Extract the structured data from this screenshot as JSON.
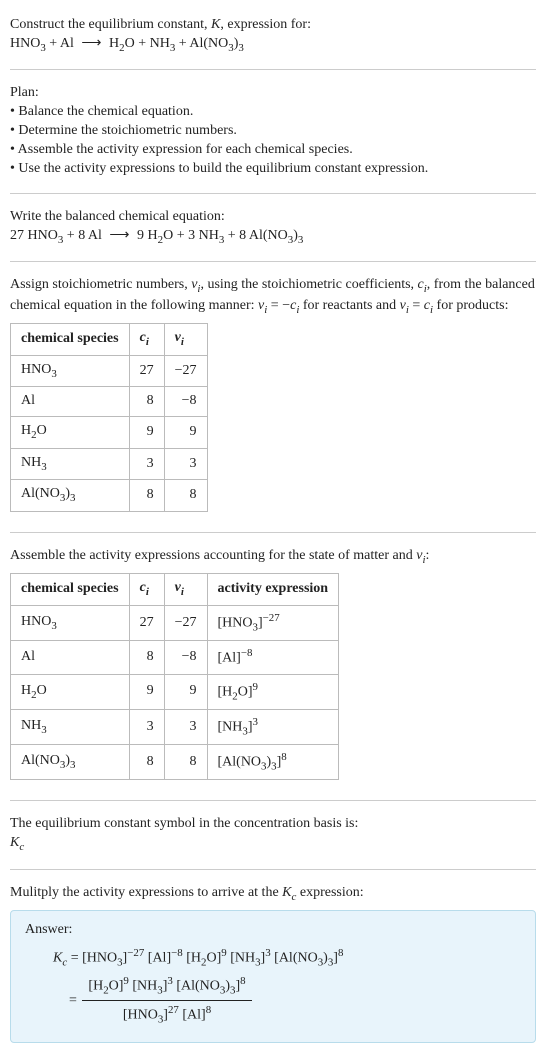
{
  "header": {
    "title_prefix": "Construct the equilibrium constant, ",
    "title_var": "K",
    "title_suffix": ", expression for:",
    "eq_lhs_1": "HNO",
    "eq_lhs_1_sub": "3",
    "eq_plus1": " + Al",
    "eq_arrow": "⟶",
    "eq_rhs_1": "H",
    "eq_rhs_1_sub": "2",
    "eq_rhs_1b": "O + NH",
    "eq_rhs_2_sub": "3",
    "eq_rhs_2b": " + Al(NO",
    "eq_rhs_3_sub": "3",
    "eq_rhs_3b": ")",
    "eq_rhs_4_sub": "3"
  },
  "plan": {
    "label": "Plan:",
    "b1": "• Balance the chemical equation.",
    "b2": "• Determine the stoichiometric numbers.",
    "b3": "• Assemble the activity expression for each chemical species.",
    "b4": "• Use the activity expressions to build the equilibrium constant expression."
  },
  "balanced": {
    "label": "Write the balanced chemical equation:",
    "c1": "27 HNO",
    "c1s": "3",
    "c2": " + 8 Al ",
    "arrow": "⟶",
    "c3": " 9 H",
    "c3s": "2",
    "c4": "O + 3 NH",
    "c4s": "3",
    "c5": " + 8 Al(NO",
    "c5s": "3",
    "c6": ")",
    "c6s": "3"
  },
  "stoich": {
    "intro_a": "Assign stoichiometric numbers, ",
    "nu": "ν",
    "i": "i",
    "intro_b": ", using the stoichiometric coefficients, ",
    "c": "c",
    "intro_c": ", from the balanced chemical equation in the following manner: ",
    "rel1a": "ν",
    "rel1b": " = −",
    "rel1c": "c",
    "rel1d": " for reactants and ",
    "rel2a": "ν",
    "rel2b": " = ",
    "rel2c": "c",
    "rel2d": " for products:"
  },
  "table1": {
    "h1": "chemical species",
    "h2c": "c",
    "h2i": "i",
    "h3n": "ν",
    "h3i": "i",
    "rows": [
      {
        "sp_a": "HNO",
        "sp_s": "3",
        "sp_b": "",
        "c": "27",
        "nu": "−27"
      },
      {
        "sp_a": "Al",
        "sp_s": "",
        "sp_b": "",
        "c": "8",
        "nu": "−8"
      },
      {
        "sp_a": "H",
        "sp_s": "2",
        "sp_b": "O",
        "c": "9",
        "nu": "9"
      },
      {
        "sp_a": "NH",
        "sp_s": "3",
        "sp_b": "",
        "c": "3",
        "nu": "3"
      },
      {
        "sp_a": "Al(NO",
        "sp_s": "3",
        "sp_b": ")",
        "sp_s2": "3",
        "c": "8",
        "nu": "8"
      }
    ]
  },
  "assemble": {
    "label_a": "Assemble the activity expressions accounting for the state of matter and ",
    "nu": "ν",
    "i": "i",
    "label_b": ":"
  },
  "table2": {
    "h1": "chemical species",
    "h2c": "c",
    "h2i": "i",
    "h3n": "ν",
    "h3i": "i",
    "h4": "activity expression",
    "rows": [
      {
        "sp_a": "HNO",
        "sp_s": "3",
        "sp_b": "",
        "c": "27",
        "nu": "−27",
        "ae_a": "[HNO",
        "ae_s": "3",
        "ae_b": "]",
        "ae_e": "−27"
      },
      {
        "sp_a": "Al",
        "sp_s": "",
        "sp_b": "",
        "c": "8",
        "nu": "−8",
        "ae_a": "[Al]",
        "ae_s": "",
        "ae_b": "",
        "ae_e": "−8"
      },
      {
        "sp_a": "H",
        "sp_s": "2",
        "sp_b": "O",
        "c": "9",
        "nu": "9",
        "ae_a": "[H",
        "ae_s": "2",
        "ae_b": "O]",
        "ae_e": "9"
      },
      {
        "sp_a": "NH",
        "sp_s": "3",
        "sp_b": "",
        "c": "3",
        "nu": "3",
        "ae_a": "[NH",
        "ae_s": "3",
        "ae_b": "]",
        "ae_e": "3"
      },
      {
        "sp_a": "Al(NO",
        "sp_s": "3",
        "sp_b": ")",
        "sp_s2": "3",
        "c": "8",
        "nu": "8",
        "ae_a": "[Al(NO",
        "ae_s": "3",
        "ae_b": ")",
        "ae_s2": "3",
        "ae_c": "]",
        "ae_e": "8"
      }
    ]
  },
  "symbol": {
    "line1": "The equilibrium constant symbol in the concentration basis is:",
    "K": "K",
    "c": "c"
  },
  "multiply": {
    "text_a": "Mulitply the activity expressions to arrive at the ",
    "K": "K",
    "c": "c",
    "text_b": " expression:"
  },
  "answer": {
    "label": "Answer:",
    "Kc_K": "K",
    "Kc_c": "c",
    "eq": " = ",
    "t1": "[HNO",
    "t1s": "3",
    "t1b": "]",
    "t1e": "−27",
    "t2": " [Al]",
    "t2e": "−8",
    "t3": " [H",
    "t3s": "2",
    "t3b": "O]",
    "t3e": "9",
    "t4": " [NH",
    "t4s": "3",
    "t4b": "]",
    "t4e": "3",
    "t5": " [Al(NO",
    "t5s": "3",
    "t5b": ")",
    "t5s2": "3",
    "t5c": "]",
    "t5e": "8",
    "eq2": " = ",
    "num_a": "[H",
    "num_as": "2",
    "num_ab": "O]",
    "num_ae": "9",
    "num_b": " [NH",
    "num_bs": "3",
    "num_bb": "]",
    "num_be": "3",
    "num_c": " [Al(NO",
    "num_cs": "3",
    "num_cb": ")",
    "num_cs2": "3",
    "num_cc": "]",
    "num_ce": "8",
    "den_a": "[HNO",
    "den_as": "3",
    "den_ab": "]",
    "den_ae": "27",
    "den_b": " [Al]",
    "den_be": "8"
  },
  "chart_data": {
    "type": "table",
    "tables": [
      {
        "title": "Stoichiometric numbers",
        "columns": [
          "chemical species",
          "c_i",
          "ν_i"
        ],
        "rows": [
          [
            "HNO3",
            27,
            -27
          ],
          [
            "Al",
            8,
            -8
          ],
          [
            "H2O",
            9,
            9
          ],
          [
            "NH3",
            3,
            3
          ],
          [
            "Al(NO3)3",
            8,
            8
          ]
        ]
      },
      {
        "title": "Activity expressions",
        "columns": [
          "chemical species",
          "c_i",
          "ν_i",
          "activity expression"
        ],
        "rows": [
          [
            "HNO3",
            27,
            -27,
            "[HNO3]^-27"
          ],
          [
            "Al",
            8,
            -8,
            "[Al]^-8"
          ],
          [
            "H2O",
            9,
            9,
            "[H2O]^9"
          ],
          [
            "NH3",
            3,
            3,
            "[NH3]^3"
          ],
          [
            "Al(NO3)3",
            8,
            8,
            "[Al(NO3)3]^8"
          ]
        ]
      }
    ]
  }
}
